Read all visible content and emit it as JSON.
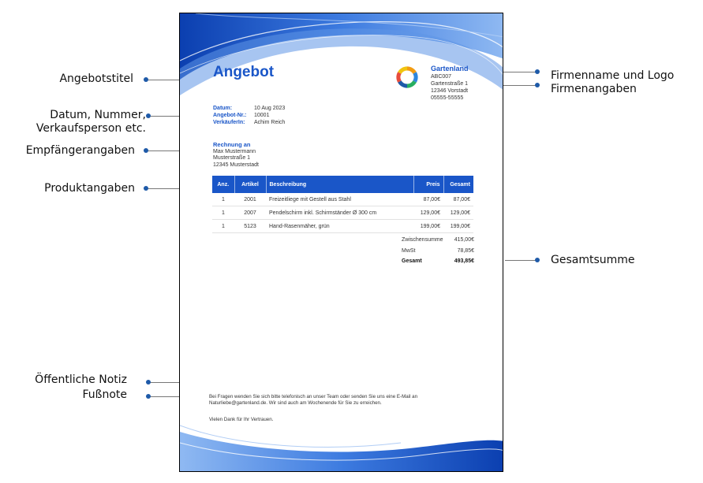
{
  "callouts": {
    "title": "Angebotstitel",
    "meta_line1": "Datum, Nummer,",
    "meta_line2": "Verkaufsperson etc.",
    "recipient": "Empfängerangaben",
    "products": "Produktangaben",
    "public_note": "Öffentliche Notiz",
    "footnote": "Fußnote",
    "company_name_logo": "Firmenname und Logo",
    "company_details": "Firmenangaben",
    "total": "Gesamtsumme"
  },
  "document": {
    "title": "Angebot",
    "company": {
      "name": "Gartenland",
      "code": "ABC007",
      "street": "Gartenstraße 1",
      "city": "12346 Vorstadt",
      "phone": "05555-55555"
    },
    "meta": {
      "date_label": "Datum:",
      "date_value": "10 Aug 2023",
      "number_label": "Angebot-Nr.:",
      "number_value": "10001",
      "seller_label": "VerkäuferIn:",
      "seller_value": "Achim Reich"
    },
    "billto": {
      "heading": "Rechnung an",
      "name": "Max Mustermann",
      "street": "Musterstraße 1",
      "city": "12345 Musterstadt"
    },
    "table": {
      "headers": [
        "Anz.",
        "Artikel",
        "Beschreibung",
        "Preis",
        "Gesamt"
      ],
      "rows": [
        [
          "1",
          "2001",
          "Freizeitliege mit Gestell aus Stahl",
          "87,00€",
          "87,00€"
        ],
        [
          "1",
          "2007",
          "Pendelschirm inkl. Schirmständer Ø 300 cm",
          "129,00€",
          "129,00€"
        ],
        [
          "1",
          "5123",
          "Hand-Rasenmäher, grün",
          "199,00€",
          "199,00€"
        ]
      ]
    },
    "totals": {
      "subtotal_label": "Zwischensumme",
      "subtotal_value": "415,00€",
      "tax_label": "MwSt",
      "tax_value": "78,85€",
      "total_label": "Gesamt",
      "total_value": "493,85€"
    },
    "note": "Bei Fragen wenden Sie sich bitte telefonisch an unser Team oder senden Sie uns eine E-Mail an Naturliebe@gartenland.de. Wir sind auch am Wochenende für Sie zu erreichen.",
    "footer": "Vielen Dank für Ihr Vertrauen."
  }
}
